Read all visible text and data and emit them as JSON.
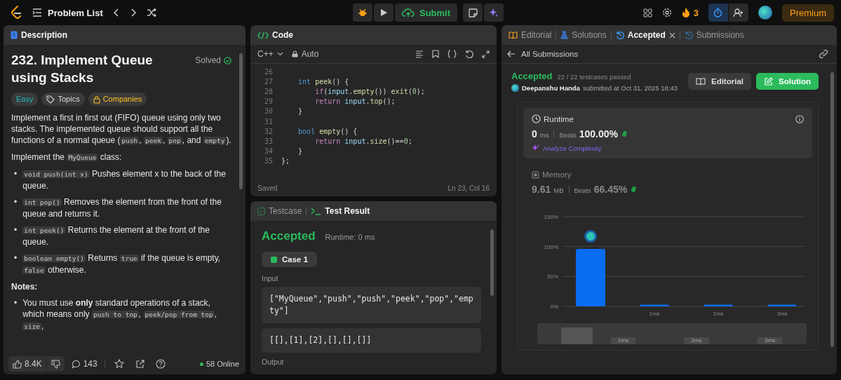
{
  "topbar": {
    "problem_list": "Problem List",
    "submit": "Submit",
    "streak": "3",
    "premium": "Premium"
  },
  "description": {
    "tab": "Description",
    "title": "232. Implement Queue using Stacks",
    "solved_label": "Solved",
    "solved": true,
    "tags": [
      {
        "label": "Easy",
        "kind": "difficulty"
      },
      {
        "label": "Topics",
        "kind": "topics"
      },
      {
        "label": "Companies",
        "kind": "companies"
      }
    ],
    "paragraphs": [
      [
        {
          "t": "Implement a first in first out (FIFO) queue using only two stacks. The implemented queue should support all the functions of a normal queue (",
          "kind": "text"
        },
        {
          "t": "push",
          "kind": "code"
        },
        {
          "t": ", ",
          "kind": "text"
        },
        {
          "t": "peek",
          "kind": "code"
        },
        {
          "t": ", ",
          "kind": "text"
        },
        {
          "t": "pop",
          "kind": "code"
        },
        {
          "t": ", and ",
          "kind": "text"
        },
        {
          "t": "empty",
          "kind": "code"
        },
        {
          "t": ").",
          "kind": "text"
        }
      ],
      [
        {
          "t": "Implement the ",
          "kind": "text"
        },
        {
          "t": "MyQueue",
          "kind": "code"
        },
        {
          "t": " class:",
          "kind": "text"
        }
      ]
    ],
    "bullets": [
      {
        "marker": "•",
        "segments": [
          {
            "t": "void push(int x)",
            "kind": "code"
          },
          {
            "t": " Pushes element x to the back of the queue.",
            "kind": "text"
          }
        ]
      },
      {
        "marker": "•",
        "segments": [
          {
            "t": "int pop()",
            "kind": "code"
          },
          {
            "t": " Removes the element from the front of the queue and returns it.",
            "kind": "text"
          }
        ]
      },
      {
        "marker": "•",
        "segments": [
          {
            "t": "int peek()",
            "kind": "code"
          },
          {
            "t": " Returns the element at the front of the queue.",
            "kind": "text"
          }
        ]
      },
      {
        "marker": "•",
        "segments": [
          {
            "t": "boolean empty()",
            "kind": "code"
          },
          {
            "t": " Returns ",
            "kind": "text"
          },
          {
            "t": "true",
            "kind": "code"
          },
          {
            "t": " if the queue is empty, ",
            "kind": "text"
          },
          {
            "t": "false",
            "kind": "code"
          },
          {
            "t": " otherwise.",
            "kind": "text"
          }
        ]
      }
    ],
    "notes_heading": "Notes:",
    "notes": [
      {
        "marker": "•",
        "segments": [
          {
            "t": "You must use ",
            "kind": "text"
          },
          {
            "t": "only",
            "kind": "bold"
          },
          {
            "t": " standard operations of a stack, which means only ",
            "kind": "text"
          },
          {
            "t": "push to top",
            "kind": "code"
          },
          {
            "t": ", ",
            "kind": "text"
          },
          {
            "t": "peek/pop from top",
            "kind": "code"
          },
          {
            "t": ", ",
            "kind": "text"
          },
          {
            "t": "size",
            "kind": "code"
          },
          {
            "t": ",",
            "kind": "text"
          }
        ]
      }
    ],
    "footer": {
      "likes": "8.4K",
      "comments": "143",
      "online": "58 Online"
    }
  },
  "code": {
    "tab": "Code",
    "language": "C++",
    "mode": "Auto",
    "lines": [
      {
        "n": "26"
      },
      {
        "n": "27",
        "tokens": [
          {
            "t": "    int",
            "kind": "type"
          },
          {
            "t": " peek",
            "kind": "fn"
          },
          {
            "t": "() {",
            "kind": "plain"
          }
        ]
      },
      {
        "n": "28",
        "tokens": [
          {
            "t": "        if",
            "kind": "ctrl"
          },
          {
            "t": "(",
            "kind": "plain"
          },
          {
            "t": "input",
            "kind": "var"
          },
          {
            "t": ".",
            "kind": "plain"
          },
          {
            "t": "empty",
            "kind": "fn"
          },
          {
            "t": "()) ",
            "kind": "plain"
          },
          {
            "t": "exit",
            "kind": "fn"
          },
          {
            "t": "(",
            "kind": "plain"
          },
          {
            "t": "0",
            "kind": "num"
          },
          {
            "t": ");",
            "kind": "plain"
          }
        ]
      },
      {
        "n": "29",
        "tokens": [
          {
            "t": "        return",
            "kind": "ctrl"
          },
          {
            "t": " input",
            "kind": "var"
          },
          {
            "t": ".",
            "kind": "plain"
          },
          {
            "t": "top",
            "kind": "fn"
          },
          {
            "t": "();",
            "kind": "plain"
          }
        ]
      },
      {
        "n": "30",
        "tokens": [
          {
            "t": "    }",
            "kind": "plain"
          }
        ]
      },
      {
        "n": "31"
      },
      {
        "n": "32",
        "tokens": [
          {
            "t": "    bool",
            "kind": "type"
          },
          {
            "t": " empty",
            "kind": "fn"
          },
          {
            "t": "() {",
            "kind": "plain"
          }
        ]
      },
      {
        "n": "33",
        "tokens": [
          {
            "t": "        return",
            "kind": "ctrl"
          },
          {
            "t": " input",
            "kind": "var"
          },
          {
            "t": ".",
            "kind": "plain"
          },
          {
            "t": "size",
            "kind": "fn"
          },
          {
            "t": "()==",
            "kind": "plain"
          },
          {
            "t": "0",
            "kind": "num"
          },
          {
            "t": ";",
            "kind": "plain"
          }
        ]
      },
      {
        "n": "34",
        "tokens": [
          {
            "t": "    }",
            "kind": "plain"
          }
        ]
      },
      {
        "n": "35",
        "tokens": [
          {
            "t": "};",
            "kind": "plain"
          }
        ]
      }
    ],
    "status": "Saved",
    "cursor": "Ln 23, Col 16"
  },
  "test": {
    "tabs": [
      {
        "label": "Testcase",
        "selected": false,
        "kind": "testcase"
      },
      {
        "label": "Test Result",
        "selected": true,
        "kind": "result"
      }
    ],
    "verdict": "Accepted",
    "runtime": "Runtime: 0 ms",
    "cases": [
      {
        "label": "Case 1",
        "passed": true
      }
    ],
    "input_label": "Input",
    "inputs": [
      "[\"MyQueue\",\"push\",\"push\",\"peek\",\"pop\",\"empty\"]",
      "[[],[1],[2],[],[],[]]"
    ],
    "output_label": "Output"
  },
  "result": {
    "tabs": [
      {
        "label": "Editorial",
        "selected": false,
        "kind": "editorial"
      },
      {
        "label": "Solutions",
        "selected": false,
        "kind": "solutions"
      },
      {
        "label": "Accepted",
        "selected": true,
        "kind": "history"
      },
      {
        "label": "Submissions",
        "selected": false,
        "kind": "history"
      }
    ],
    "back": "All Submissions",
    "verdict": "Accepted",
    "passed": "22 / 22 testcases passed",
    "user": "Deepanshu Handa",
    "submitted": "submitted at Oct 31, 2025 18:43",
    "buttons": [
      {
        "label": "Editorial",
        "kind": "secondary"
      },
      {
        "label": "Solution",
        "kind": "primary"
      }
    ],
    "stats": [
      {
        "label": "Runtime",
        "kind": "runtime",
        "selected": true,
        "value": "0",
        "unit": "ms",
        "beats_label": "Beats",
        "beats": "100.00%",
        "analyze": "Analyze Complexity"
      },
      {
        "label": "Memory",
        "kind": "memory",
        "selected": false,
        "value": "9.61",
        "unit": "MB",
        "beats_label": "Beats",
        "beats": "66.45%"
      }
    ],
    "chart_data": {
      "type": "bar",
      "categories": [
        null,
        "1ms",
        "2ms",
        "3ms"
      ],
      "values": [
        96,
        3,
        3,
        3
      ],
      "ylim": [
        0,
        150
      ],
      "yticks": [
        {
          "value": 0,
          "label": "0%"
        },
        {
          "value": 50,
          "label": "50%"
        },
        {
          "value": 100,
          "label": "100%"
        },
        {
          "value": 150,
          "label": "150%"
        }
      ]
    },
    "overview_labels": [
      "1ms",
      "2ms",
      "3ms"
    ]
  }
}
